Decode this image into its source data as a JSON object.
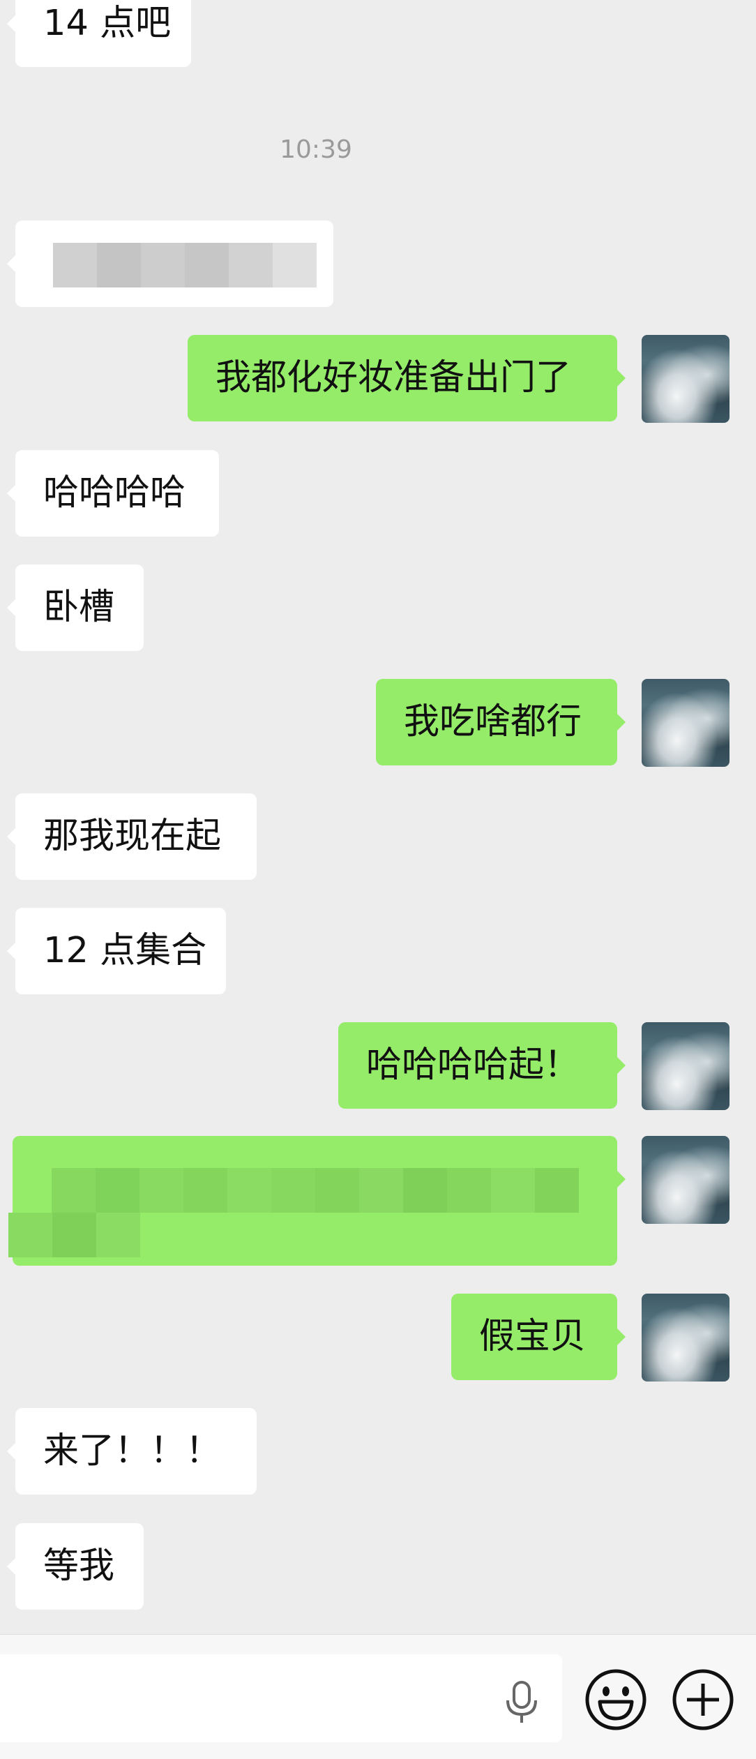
{
  "timestamp": "10:39",
  "messages": {
    "m0": "14 点吧",
    "m2": "我都化好妆准备出门了",
    "m3": "哈哈哈哈",
    "m4": "卧槽",
    "m5": "我吃啥都行",
    "m6": "那我现在起",
    "m7": "12 点集合",
    "m8": "哈哈哈哈起！",
    "m10": "假宝贝",
    "m11": "来了！！！",
    "m12": "等我"
  },
  "icons": {
    "voice": "microphone-icon",
    "emoji": "smiley-icon",
    "more": "plus-circle-icon"
  },
  "colors": {
    "background": "#ededed",
    "incoming_bubble": "#ffffff",
    "outgoing_bubble": "#95ec69"
  }
}
